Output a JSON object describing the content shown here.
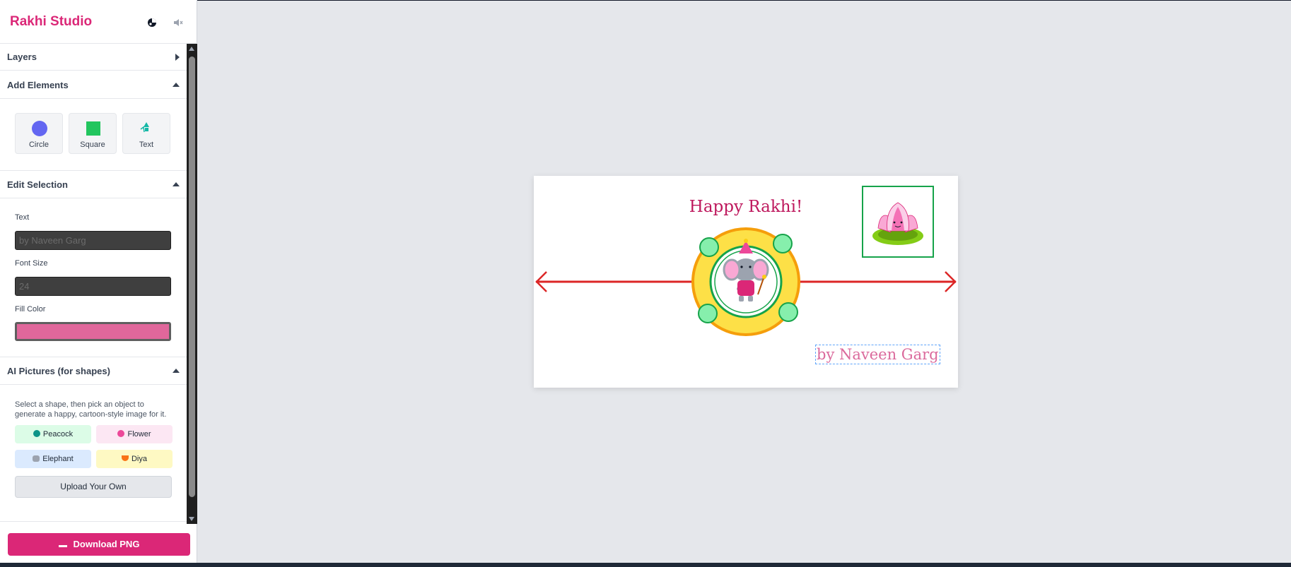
{
  "app": {
    "title": "Rakhi Studio"
  },
  "sidebar": {
    "layers": {
      "label": "Layers"
    },
    "add_elements": {
      "label": "Add Elements",
      "buttons": [
        {
          "label": "Circle"
        },
        {
          "label": "Square"
        },
        {
          "label": "Text"
        }
      ]
    },
    "edit_selection": {
      "label": "Edit Selection",
      "text_label": "Text",
      "text_value": "by Naveen Garg",
      "font_size_label": "Font Size",
      "font_size_value": "24",
      "fill_color_label": "Fill Color",
      "fill_color": "#e0679b"
    },
    "ai_pictures": {
      "label": "AI Pictures (for shapes)",
      "description": "Select a shape, then pick an object to generate a happy, cartoon-style image for it.",
      "options": [
        {
          "label": "Peacock",
          "icon": "peacock-icon",
          "color": "#dcfce7"
        },
        {
          "label": "Flower",
          "icon": "flower-icon",
          "color": "#fce7f3"
        },
        {
          "label": "Elephant",
          "icon": "elephant-icon",
          "color": "#dbeafe"
        },
        {
          "label": "Diya",
          "icon": "diya-icon",
          "color": "#fef9c3"
        }
      ],
      "upload_label": "Upload Your Own"
    },
    "download_label": "Download PNG"
  },
  "canvas": {
    "title": "Happy Rakhi!",
    "byline": "by Naveen Garg",
    "thread_color": "#dc2626",
    "center_ring_color": "#fde047"
  },
  "colors": {
    "accent": "#db2777"
  }
}
